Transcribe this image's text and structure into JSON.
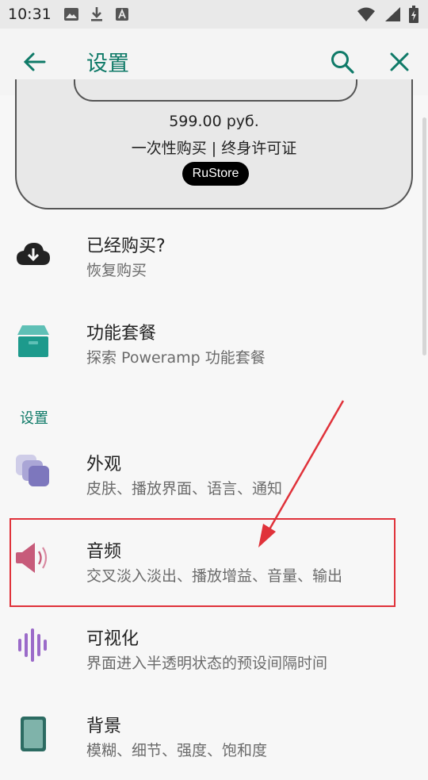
{
  "status_bar": {
    "time": "10:31",
    "left_icons": [
      "image-icon",
      "download-icon",
      "text-a-icon"
    ],
    "right_icons": [
      "wifi-icon",
      "signal-icon",
      "battery-icon"
    ]
  },
  "app_bar": {
    "title": "设置",
    "back_icon": "arrow-left-icon",
    "search_icon": "search-icon",
    "close_icon": "close-icon",
    "accent": "#0f7a68"
  },
  "purchase_card": {
    "price": "599.00 руб.",
    "license": "一次性购买 | 终身许可证",
    "store_button": "RuStore"
  },
  "items": [
    {
      "title": "已经购买?",
      "subtitle": "恢复购买",
      "icon": "cloud-download-icon"
    },
    {
      "title": "功能套餐",
      "subtitle": "探索 Poweramp 功能套餐",
      "icon": "package-box-icon"
    }
  ],
  "settings_section": {
    "header": "设置",
    "items": [
      {
        "title": "外观",
        "subtitle": "皮肤、播放界面、语言、通知",
        "icon": "layers-icon"
      },
      {
        "title": "音频",
        "subtitle": "交叉淡入淡出、播放增益、音量、输出",
        "icon": "speaker-icon"
      },
      {
        "title": "可视化",
        "subtitle": "界面进入半透明状态的预设间隔时间",
        "icon": "waveform-icon"
      },
      {
        "title": "背景",
        "subtitle": "模糊、细节、强度、饱和度",
        "icon": "background-image-icon"
      }
    ]
  },
  "annotation": {
    "highlight_color": "#e0323a"
  }
}
